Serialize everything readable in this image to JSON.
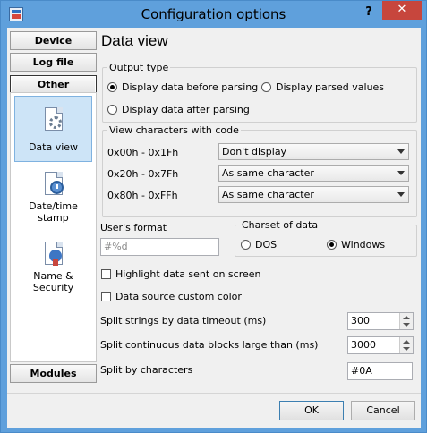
{
  "window": {
    "title": "Configuration options",
    "help_label": "?",
    "close_label": "✕"
  },
  "nav": {
    "buttons_top": [
      {
        "label": "Device"
      },
      {
        "label": "Log file"
      },
      {
        "label": "Other"
      }
    ],
    "items": [
      {
        "label": "Data view",
        "icon": "gear-document-icon"
      },
      {
        "label": "Date/time stamp",
        "icon": "clock-document-icon"
      },
      {
        "label": "Name & Security",
        "icon": "lock-document-icon"
      }
    ],
    "bottom_button": {
      "label": "Modules"
    }
  },
  "page": {
    "title": "Data view",
    "output_type": {
      "legend": "Output type",
      "options": [
        {
          "label": "Display data before parsing",
          "selected": true
        },
        {
          "label": "Display parsed values",
          "selected": false
        },
        {
          "label": "Display data after parsing",
          "selected": false
        }
      ]
    },
    "view_chars": {
      "legend": "View characters with code",
      "rows": [
        {
          "range": "0x00h - 0x1Fh",
          "value": "Don't display"
        },
        {
          "range": "0x20h - 0x7Fh",
          "value": "As same character"
        },
        {
          "range": "0x80h - 0xFFh",
          "value": "As same character"
        }
      ]
    },
    "user_format": {
      "label": "User's format",
      "placeholder": "#%d"
    },
    "charset": {
      "legend": "Charset of data",
      "options": [
        {
          "label": "DOS",
          "selected": false
        },
        {
          "label": "Windows",
          "selected": true
        }
      ]
    },
    "checkboxes": [
      {
        "label": "Highlight data sent on screen",
        "checked": false
      },
      {
        "label": "Data source custom color",
        "checked": false
      }
    ],
    "split_timeout": {
      "label": "Split strings by data timeout (ms)",
      "value": "300"
    },
    "split_blocks": {
      "label": "Split continuous data blocks large than (ms)",
      "value": "3000"
    },
    "split_chars": {
      "label": "Split by characters",
      "value": "#0A"
    }
  },
  "footer": {
    "ok_label": "OK",
    "cancel_label": "Cancel"
  }
}
